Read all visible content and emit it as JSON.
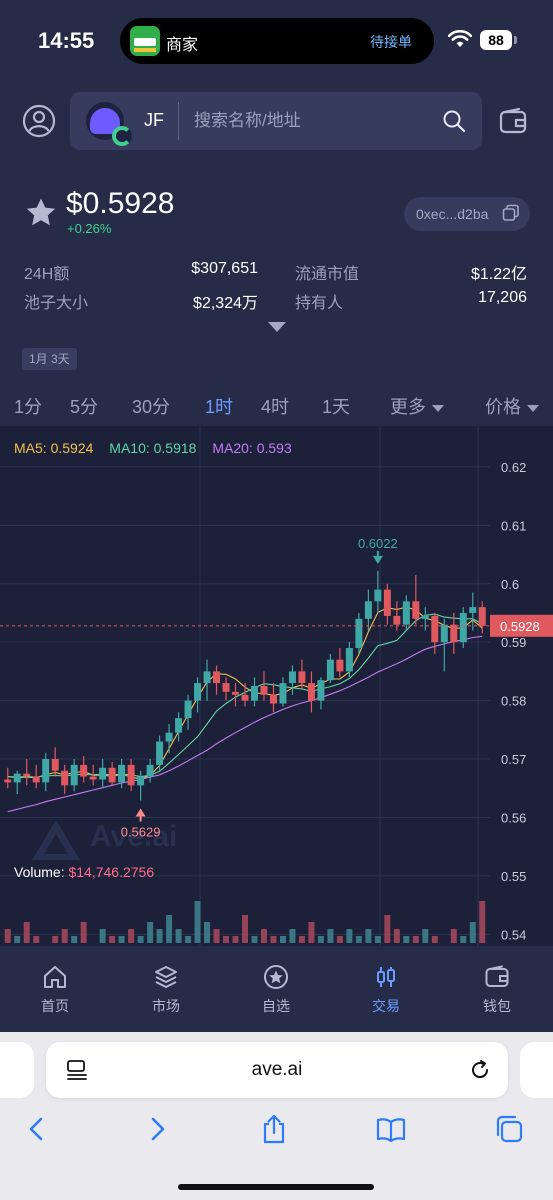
{
  "status_bar": {
    "time": "14:55",
    "island_title": "商家",
    "island_action": "待接单",
    "battery": "88"
  },
  "search": {
    "token_ticker": "JF",
    "placeholder": "搜索名称/地址"
  },
  "token": {
    "price": "$0.5928",
    "change": "+0.26%",
    "address": "0xec...d2ba"
  },
  "stats": [
    {
      "label": "24H额",
      "value": "$307,651"
    },
    {
      "label": "流通市值",
      "value": "$1.22亿"
    },
    {
      "label": "池子大小",
      "value": "$2,324万"
    },
    {
      "label": "持有人",
      "value": "17,206"
    }
  ],
  "date_tag": "1月 3天",
  "tabs": [
    "1分",
    "5分",
    "30分",
    "1时",
    "4时",
    "1天"
  ],
  "active_tab": "1时",
  "more_label": "更多",
  "price_label": "价格",
  "chart": {
    "ma5": "MA5: 0.5924",
    "ma10": "MA10: 0.5918",
    "ma20": "MA20: 0.593",
    "high_marker": "0.6022",
    "low_marker": "0.5629",
    "current_price_tag": "0.5928",
    "y_ticks": [
      "0.62",
      "0.61",
      "0.6",
      "0.59",
      "0.58",
      "0.57",
      "0.56",
      "0.55",
      "0.54"
    ],
    "volume_label": "Volume:",
    "volume_value": "$14,746.2756",
    "watermark": "Ave.ai",
    "colors": {
      "up": "#3fa7a5",
      "down": "#e0595f",
      "ma5": "#f1c24a",
      "ma10": "#5fd7a4",
      "ma20": "#c47cf3"
    }
  },
  "chart_data": {
    "type": "candlestick",
    "title": "",
    "ylim": [
      0.538,
      0.627
    ],
    "current_price": 0.5928,
    "high": 0.6022,
    "low": 0.5629,
    "candles": [
      [
        0.5665,
        0.5685,
        0.565,
        0.566
      ],
      [
        0.566,
        0.568,
        0.564,
        0.5675
      ],
      [
        0.5675,
        0.57,
        0.5655,
        0.567
      ],
      [
        0.567,
        0.569,
        0.565,
        0.566
      ],
      [
        0.566,
        0.571,
        0.5645,
        0.57
      ],
      [
        0.57,
        0.572,
        0.567,
        0.568
      ],
      [
        0.568,
        0.569,
        0.564,
        0.5655
      ],
      [
        0.5655,
        0.57,
        0.5645,
        0.569
      ],
      [
        0.569,
        0.5705,
        0.566,
        0.567
      ],
      [
        0.567,
        0.569,
        0.5655,
        0.5665
      ],
      [
        0.5665,
        0.57,
        0.565,
        0.5685
      ],
      [
        0.5685,
        0.5695,
        0.5655,
        0.566
      ],
      [
        0.566,
        0.57,
        0.565,
        0.569
      ],
      [
        0.569,
        0.57,
        0.5645,
        0.5655
      ],
      [
        0.5655,
        0.568,
        0.5629,
        0.567
      ],
      [
        0.567,
        0.57,
        0.566,
        0.569
      ],
      [
        0.569,
        0.574,
        0.568,
        0.573
      ],
      [
        0.573,
        0.576,
        0.571,
        0.5745
      ],
      [
        0.5745,
        0.578,
        0.573,
        0.577
      ],
      [
        0.577,
        0.581,
        0.575,
        0.58
      ],
      [
        0.58,
        0.584,
        0.578,
        0.583
      ],
      [
        0.583,
        0.587,
        0.58,
        0.585
      ],
      [
        0.585,
        0.586,
        0.581,
        0.583
      ],
      [
        0.583,
        0.584,
        0.58,
        0.5815
      ],
      [
        0.5815,
        0.583,
        0.579,
        0.581
      ],
      [
        0.581,
        0.583,
        0.579,
        0.58
      ],
      [
        0.58,
        0.584,
        0.579,
        0.5825
      ],
      [
        0.5825,
        0.585,
        0.58,
        0.581
      ],
      [
        0.581,
        0.583,
        0.578,
        0.5795
      ],
      [
        0.5795,
        0.584,
        0.579,
        0.583
      ],
      [
        0.583,
        0.586,
        0.581,
        0.585
      ],
      [
        0.585,
        0.587,
        0.582,
        0.583
      ],
      [
        0.583,
        0.585,
        0.578,
        0.58
      ],
      [
        0.58,
        0.584,
        0.5785,
        0.5835
      ],
      [
        0.5835,
        0.588,
        0.583,
        0.587
      ],
      [
        0.587,
        0.589,
        0.584,
        0.585
      ],
      [
        0.585,
        0.59,
        0.584,
        0.589
      ],
      [
        0.589,
        0.595,
        0.588,
        0.594
      ],
      [
        0.594,
        0.599,
        0.592,
        0.597
      ],
      [
        0.597,
        0.6022,
        0.595,
        0.599
      ],
      [
        0.599,
        0.6,
        0.593,
        0.5945
      ],
      [
        0.5945,
        0.597,
        0.592,
        0.593
      ],
      [
        0.593,
        0.598,
        0.592,
        0.597
      ],
      [
        0.597,
        0.6015,
        0.593,
        0.594
      ],
      [
        0.594,
        0.596,
        0.592,
        0.5945
      ],
      [
        0.5945,
        0.595,
        0.588,
        0.59
      ],
      [
        0.59,
        0.594,
        0.585,
        0.593
      ],
      [
        0.593,
        0.595,
        0.588,
        0.59
      ],
      [
        0.59,
        0.596,
        0.589,
        0.595
      ],
      [
        0.595,
        0.5985,
        0.592,
        0.596
      ],
      [
        0.596,
        0.597,
        0.5915,
        0.5928
      ]
    ],
    "ma_series": [
      {
        "name": "MA5",
        "values": [
          0.567,
          0.5668,
          0.5669,
          0.5668,
          0.5673,
          0.5677,
          0.5673,
          0.5677,
          0.5679,
          0.5672,
          0.5673,
          0.567,
          0.5674,
          0.5669,
          0.5666,
          0.5672,
          0.5689,
          0.5718,
          0.5747,
          0.5776,
          0.5805,
          0.5832,
          0.5846,
          0.5845,
          0.5837,
          0.5823,
          0.5813,
          0.5812,
          0.5809,
          0.5812,
          0.5822,
          0.5827,
          0.5821,
          0.5829,
          0.5837,
          0.5837,
          0.5849,
          0.5879,
          0.5918,
          0.5951,
          0.5959,
          0.5956,
          0.596,
          0.5955,
          0.5941,
          0.5937,
          0.5929,
          0.5923,
          0.5925,
          0.5938,
          0.5924
        ]
      },
      {
        "name": "MA10",
        "values": [
          0.567,
          0.5669,
          0.567,
          0.5669,
          0.5671,
          0.5672,
          0.5671,
          0.5673,
          0.5674,
          0.5673,
          0.5674,
          0.5673,
          0.5674,
          0.5673,
          0.567,
          0.5672,
          0.5679,
          0.5693,
          0.5708,
          0.5723,
          0.5738,
          0.576,
          0.5782,
          0.5795,
          0.5806,
          0.5814,
          0.5822,
          0.5829,
          0.5827,
          0.5824,
          0.5822,
          0.582,
          0.5816,
          0.582,
          0.5824,
          0.5829,
          0.5838,
          0.5853,
          0.5873,
          0.5894,
          0.5898,
          0.5903,
          0.592,
          0.5937,
          0.5946,
          0.5948,
          0.5943,
          0.5941,
          0.594,
          0.594,
          0.5931
        ]
      },
      {
        "name": "MA20",
        "values": [
          0.561,
          0.5614,
          0.5618,
          0.5622,
          0.5627,
          0.5631,
          0.5635,
          0.5639,
          0.5643,
          0.5647,
          0.5651,
          0.5655,
          0.5659,
          0.5662,
          0.5665,
          0.5669,
          0.5673,
          0.568,
          0.5688,
          0.5697,
          0.5706,
          0.5715,
          0.5726,
          0.5736,
          0.5745,
          0.5754,
          0.5763,
          0.5771,
          0.5778,
          0.5785,
          0.5791,
          0.5796,
          0.58,
          0.5805,
          0.5811,
          0.5817,
          0.5824,
          0.5832,
          0.584,
          0.5849,
          0.5856,
          0.5863,
          0.5871,
          0.588,
          0.5888,
          0.5893,
          0.5897,
          0.5901,
          0.5904,
          0.5908,
          0.591
        ]
      }
    ],
    "volumes": [
      2,
      1,
      3,
      1,
      0,
      1,
      2,
      1,
      3,
      0,
      2,
      1,
      1,
      2,
      1,
      3,
      2,
      4,
      2,
      1,
      6,
      3,
      2,
      1,
      1,
      4,
      1,
      2,
      1,
      1,
      2,
      1,
      3,
      1,
      2,
      1,
      2,
      1,
      2,
      1,
      4,
      2,
      1,
      1,
      2,
      1,
      0,
      2,
      1,
      3,
      6
    ]
  },
  "nav": [
    {
      "label": "首页",
      "icon": "home-icon"
    },
    {
      "label": "市场",
      "icon": "layers-icon"
    },
    {
      "label": "自选",
      "icon": "star-circle-icon"
    },
    {
      "label": "交易",
      "icon": "candles-icon"
    },
    {
      "label": "钱包",
      "icon": "wallet-icon"
    }
  ],
  "active_nav": "交易",
  "browser": {
    "url": "ave.ai"
  }
}
